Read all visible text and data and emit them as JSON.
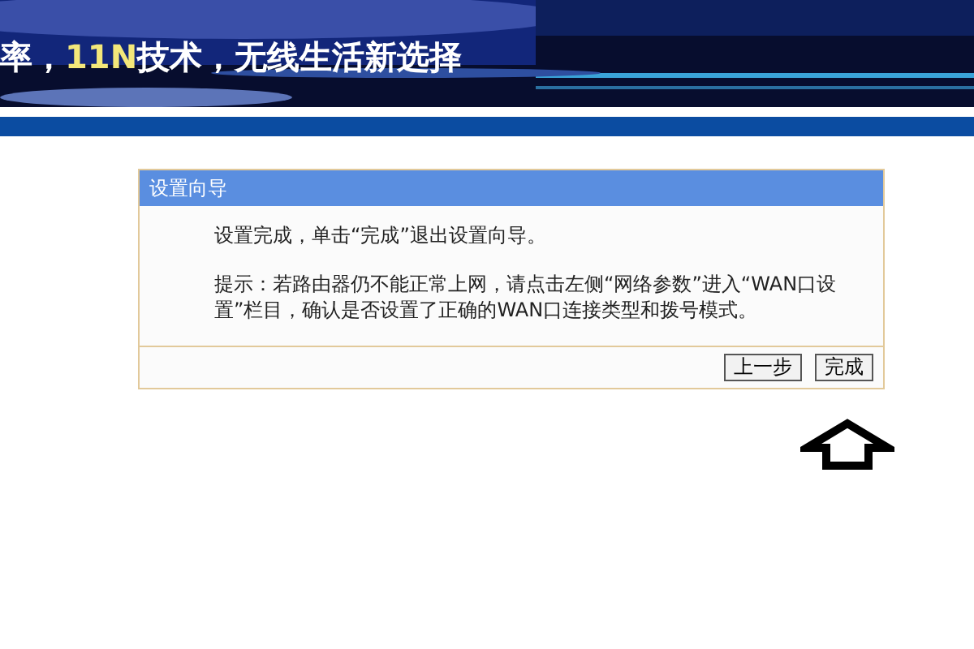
{
  "banner": {
    "slogan": [
      {
        "text": "率，",
        "highlight": false
      },
      {
        "text": "11N",
        "highlight": true
      },
      {
        "text": "技术，无线生活新选择",
        "highlight": false
      }
    ]
  },
  "dialog": {
    "title": "设置向导",
    "paragraphs": [
      "设置完成，单击“完成”退出设置向导。",
      "提示：若路由器仍不能正常上网，请点击左侧“网络参数”进入“WAN口设置”栏目，确认是否设置了正确的WAN口连接类型和拨号模式。"
    ],
    "buttons": [
      "上一步",
      "完成"
    ]
  }
}
